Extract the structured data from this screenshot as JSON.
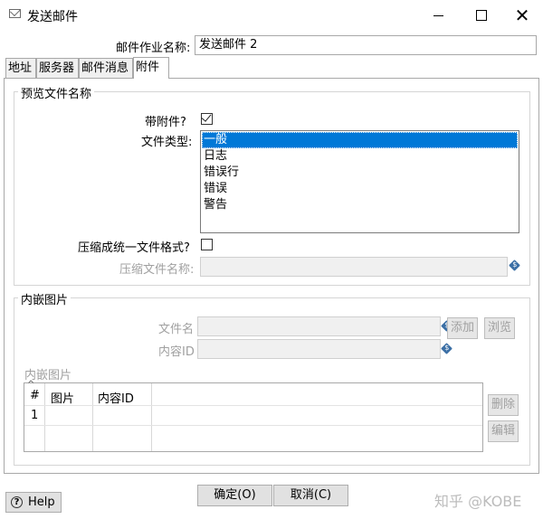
{
  "window": {
    "title": "发送邮件",
    "minimize_label": "",
    "maximize_label": "",
    "close_label": "✕"
  },
  "job": {
    "name_label": "邮件作业名称:",
    "name_value": "发送邮件 2"
  },
  "tabs": [
    {
      "label": "地址",
      "active": false
    },
    {
      "label": "服务器",
      "active": false
    },
    {
      "label": "邮件消息",
      "active": false
    },
    {
      "label": "附件",
      "active": true
    }
  ],
  "preview": {
    "group_title": "预览文件名称",
    "with_attachment_label": "带附件?",
    "with_attachment_checked": true,
    "file_type_label": "文件类型:",
    "file_types": [
      "一般",
      "日志",
      "错误行",
      "错误",
      "警告"
    ],
    "selected_index": 0,
    "zip_label": "压缩成统一文件格式?",
    "zip_checked": false,
    "zip_name_label": "压缩文件名称:",
    "zip_name_value": ""
  },
  "embedded": {
    "group_title": "内嵌图片",
    "filename_label": "文件名",
    "filename_value": "",
    "content_id_label": "内容ID",
    "content_id_value": "",
    "add_button": "添加",
    "browse_button": "浏览",
    "table_title": "内嵌图片",
    "table_headers": [
      "#",
      "图片",
      "内容ID"
    ],
    "table_rows": [
      [
        "1",
        "",
        ""
      ]
    ],
    "sort_indicator": "^",
    "delete_button": "删除",
    "edit_button": "编辑"
  },
  "footer": {
    "ok_button": "确定(O)",
    "cancel_button": "取消(C)",
    "help_button": "Help",
    "watermark": "知乎 @KOBE"
  },
  "icons": {
    "title": "mail-icon",
    "variable": "variable-diamond-icon",
    "help": "help-icon"
  },
  "colors": {
    "selection": "#0078d7",
    "variable_icon": "#3a6ea5"
  }
}
